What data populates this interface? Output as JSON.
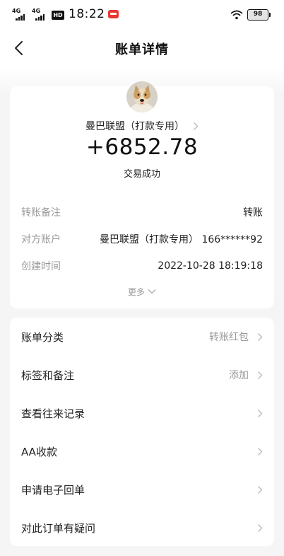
{
  "status_bar": {
    "net1": "4G",
    "net2": "4G",
    "hd": "HD",
    "time": "18:22",
    "battery": "98"
  },
  "nav": {
    "title": "账单详情"
  },
  "transaction": {
    "merchant": "曼巴联盟（打款专用）",
    "amount": "+6852.78",
    "status": "交易成功"
  },
  "details": [
    {
      "label": "转账备注",
      "value": "转账"
    },
    {
      "label": "对方账户",
      "value": "曼巴联盟（打款专用） 166******92"
    },
    {
      "label": "创建时间",
      "value": "2022-10-28 18:19:18"
    }
  ],
  "more": {
    "label": "更多"
  },
  "menu": [
    {
      "label": "账单分类",
      "value": "转账红包"
    },
    {
      "label": "标签和备注",
      "value": "添加"
    },
    {
      "label": "查看往来记录",
      "value": ""
    },
    {
      "label": "AA收款",
      "value": ""
    },
    {
      "label": "申请电子回单",
      "value": ""
    },
    {
      "label": "对此订单有疑问",
      "value": ""
    }
  ],
  "colors": {
    "background": "#f5f5f5",
    "card": "#ffffff",
    "muted_text": "#999999",
    "primary_text": "#222222"
  },
  "icons": [
    "back-arrow-icon",
    "wifi-icon",
    "battery-icon",
    "chevron-right-icon",
    "chevron-down-icon",
    "avatar-dog-image"
  ]
}
